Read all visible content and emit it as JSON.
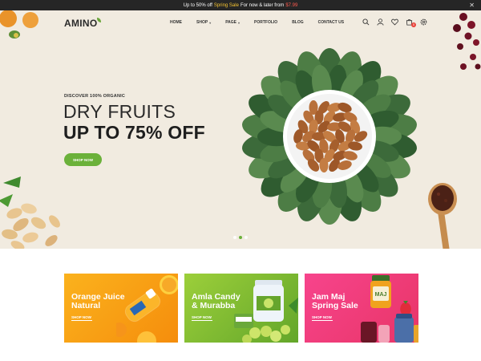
{
  "topbar": {
    "text_before": "Up to 50% off",
    "highlight": "Spring Sale",
    "text_after": "For now & later from",
    "price": "$7.99",
    "close": "✕"
  },
  "header": {
    "logo": "AMINO",
    "nav": [
      {
        "label": "HOME",
        "has_dropdown": false
      },
      {
        "label": "SHOP",
        "has_dropdown": true
      },
      {
        "label": "PAGE",
        "has_dropdown": true
      },
      {
        "label": "PORTFOLIO",
        "has_dropdown": false
      },
      {
        "label": "BLOG",
        "has_dropdown": false
      },
      {
        "label": "CONTACT US",
        "has_dropdown": false
      }
    ],
    "icons": [
      "search-icon",
      "user-icon",
      "heart-icon",
      "cart-icon",
      "settings-icon"
    ],
    "cart_count": "0"
  },
  "hero": {
    "kicker": "DISCOVER 100% ORGANIC",
    "title_line1": "DRY FRUITS",
    "title_line2": "UP TO 75% OFF",
    "button": "SHOP NOW",
    "slide_count": 3,
    "active_slide": 2
  },
  "banners": [
    {
      "title_line1": "Orange Juice",
      "title_line2": "Natural",
      "link": "SHOP NOW"
    },
    {
      "title_line1": "Amla Candy",
      "title_line2": "& Murabba",
      "link": "SHOP NOW"
    },
    {
      "title_line1": "Jam Maj",
      "title_line2": "Spring Sale",
      "link": "SHOP NOW"
    }
  ],
  "banner_product_label": "MAJ",
  "colors": {
    "accent": "#6bb13a",
    "hero_bg": "#f1ebe0",
    "topbar_bg": "#262626",
    "banner_orange": "#fbb21d",
    "banner_green": "#8cc63f",
    "banner_pink": "#f23e7e",
    "sale_yellow": "#f6c431",
    "price_red": "#ff5a4e"
  }
}
